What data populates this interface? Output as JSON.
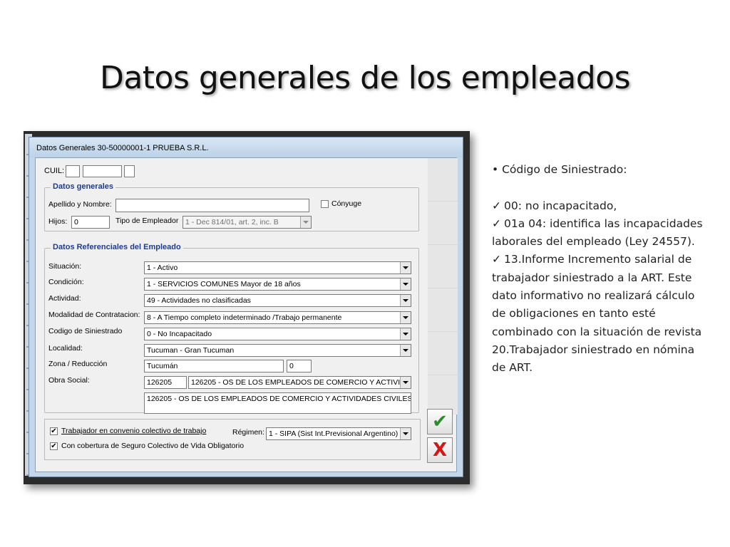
{
  "slide": {
    "title": "Datos generales de los empleados"
  },
  "window": {
    "title": "Datos Generales  30-50000001-1   PRUEBA S.R.L."
  },
  "form": {
    "cuil_label": "CUIL:",
    "datos_generales": {
      "title": "Datos generales",
      "apellido_label": "Apellido y Nombre:",
      "apellido_value": "",
      "conyuge_label": "Cónyuge",
      "hijos_label": "Hijos:",
      "hijos_value": "0",
      "tipo_empleador_label": "Tipo de Empleador",
      "tipo_empleador_value": "1 - Dec 814/01, art. 2, inc. B"
    },
    "referenciales": {
      "title": "Datos Referenciales del Empleado",
      "situacion_label": "Situación:",
      "situacion_value": "1 - Activo",
      "condicion_label": "Condición:",
      "condicion_value": "1 - SERVICIOS COMUNES Mayor de 18 años",
      "actividad_label": "Actividad:",
      "actividad_value": "49 - Actividades no clasificadas",
      "modalidad_label": "Modalidad de Contratacion:",
      "modalidad_value": "8 - A Tiempo completo indeterminado /Trabajo permanente",
      "siniestrado_label": "Codigo de Siniestrado",
      "siniestrado_value": "0 - No Incapacitado",
      "localidad_label": "Localidad:",
      "localidad_value": "Tucuman - Gran Tucuman",
      "zona_label": "Zona / Reducción",
      "zona_value": "Tucumán",
      "zona_reduccion_value": "0",
      "obra_social_label": "Obra Social:",
      "obra_social_code": "126205",
      "obra_social_value": "126205 - OS  DE LOS EMPLEADOS DE COMERCIO Y ACTIVI",
      "obra_social_full": "126205 - OS  DE LOS EMPLEADOS DE COMERCIO Y ACTIVIDADES CIVILES"
    },
    "bottom": {
      "convenio_label": "Trabajador en convenio colectivo de trabajo",
      "convenio_checked": true,
      "seguro_label": "Con cobertura de Seguro Colectivo de Vida Obligatorio",
      "seguro_checked": true,
      "regimen_label": "Régimen:",
      "regimen_value": "1 - SIPA (Sist Int.Previsional Argentino)"
    },
    "buttons": {
      "ok_symbol": "✔",
      "cancel_symbol": "X"
    }
  },
  "notes": {
    "heading_bullet": "•",
    "heading": "Código de Siniestrado",
    "heading_suffix": ":",
    "items": [
      "00: no incapacitado,",
      "01a 04: identifica las incapacidades laborales del empleado (Ley 24557).",
      "13.Informe Incremento salarial de trabajador siniestrado a la ART. Este dato informativo no realizará cálculo de obligaciones en tanto esté combinado con la situación de revista 20.Trabajador siniestrado en nómina de ART."
    ],
    "check_symbol": "✓"
  },
  "colors": {
    "group_title": "#1f3c8a",
    "ok_green": "#2e8b2e",
    "cancel_red": "#d11919"
  }
}
